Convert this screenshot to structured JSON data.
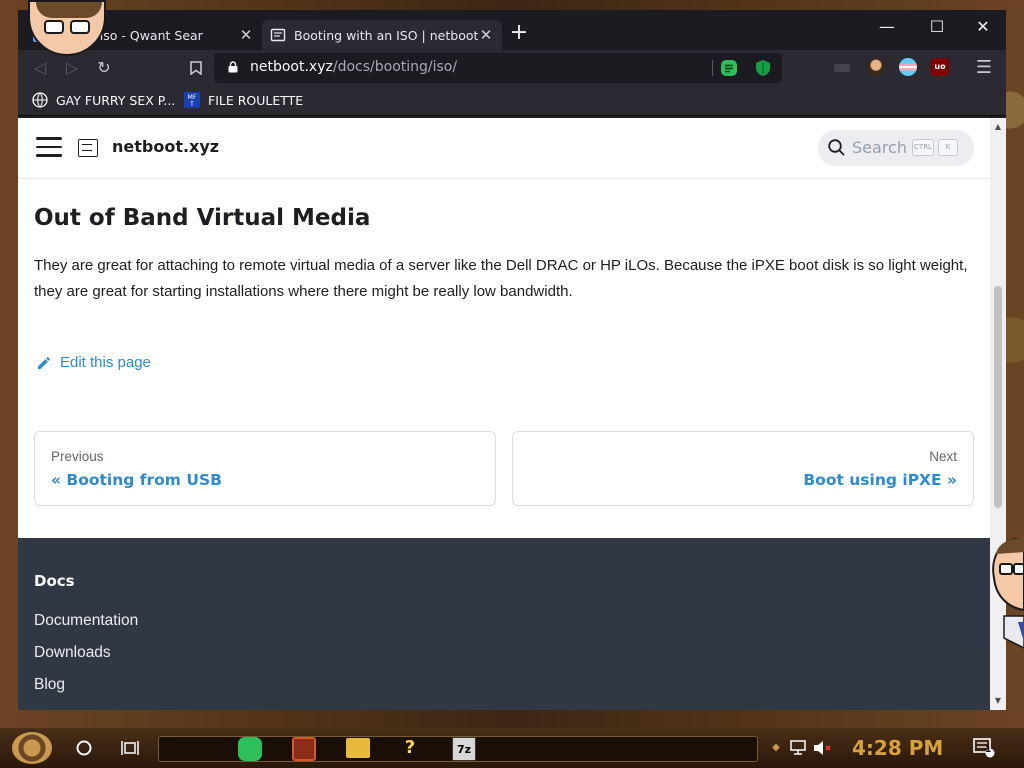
{
  "browser": {
    "tabs": [
      {
        "title": "hybrid iso - Qwant Sear",
        "close": "✕",
        "active": false
      },
      {
        "title": "Booting with an ISO | netboot.x",
        "close": "✕",
        "active": true
      }
    ],
    "new_tab": "+",
    "window_controls": {
      "minimize": "—",
      "maximize": "☐",
      "close": "✕"
    },
    "url": {
      "host": "netboot.xyz",
      "path": "/docs/booting/iso/"
    },
    "bookmarks": [
      {
        "label": "GAY FURRY SEX P...",
        "icon": "globe-icon"
      },
      {
        "label": "FILE ROULETTE",
        "icon": "mft-icon"
      }
    ]
  },
  "site": {
    "brand": "netboot.xyz",
    "search": {
      "placeholder": "Search",
      "key1": "CTRL",
      "key2": "K"
    }
  },
  "content": {
    "heading": "Out of Band Virtual Media",
    "paragraph": "They are great for attaching to remote virtual media of a server like the Dell DRAC or HP iLOs. Because the iPXE boot disk is so light weight, they are great for starting installations where there might be really low bandwidth.",
    "edit_link": "Edit this page"
  },
  "pagination": {
    "prev": {
      "sub": "Previous",
      "label": "« Booting from USB"
    },
    "next": {
      "sub": "Next",
      "label": "Boot using iPXE »"
    }
  },
  "footer": {
    "title": "Docs",
    "links": [
      "Documentation",
      "Downloads",
      "Blog"
    ]
  },
  "taskbar": {
    "clock": "4:28 PM",
    "notification_count": "1"
  },
  "colors": {
    "link": "#2e8bd0",
    "footer_bg": "#303846",
    "browser_chrome": "#2b2a33"
  }
}
